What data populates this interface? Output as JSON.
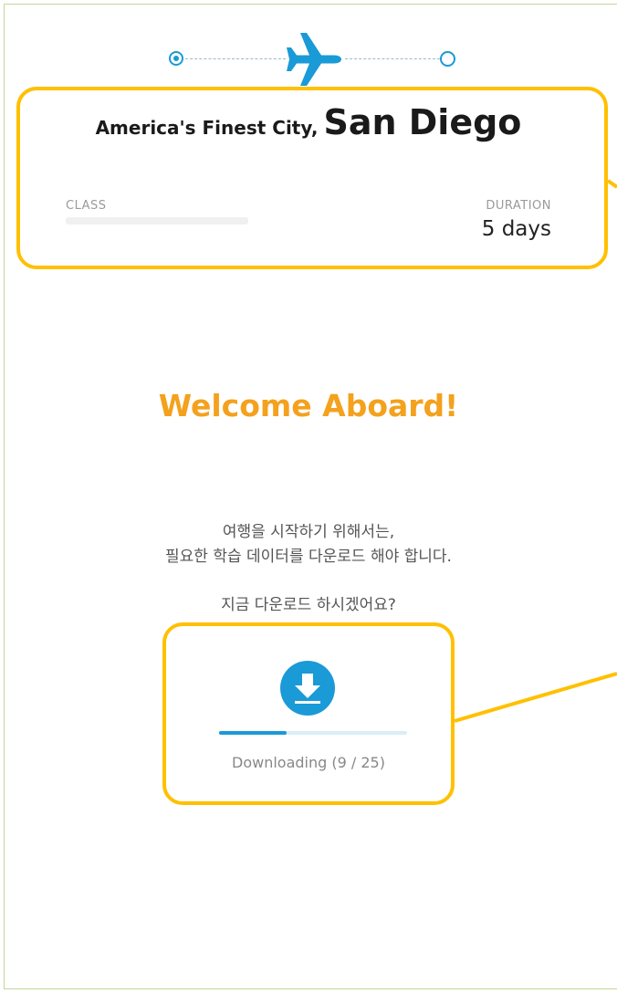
{
  "header": {
    "subtitle": "America's Finest City,",
    "city": "San Diego"
  },
  "info": {
    "class_label": "CLASS",
    "duration_label": "DURATION",
    "duration_value": "5 days"
  },
  "welcome": {
    "title": "Welcome Aboard!",
    "message_line1": "여행을 시작하기 위해서는,",
    "message_line2": "필요한 학습 데이터를 다운로드 해야 합니다.",
    "question": "지금 다운로드 하시겠어요?"
  },
  "download": {
    "icon": "download-icon",
    "status": "Downloading (9 / 25)",
    "current": 9,
    "total": 25,
    "progress_fraction": 0.36
  },
  "colors": {
    "accent_blue": "#1a9ad6",
    "welcome_orange": "#f4a11d",
    "highlight_yellow": "#ffc000"
  }
}
